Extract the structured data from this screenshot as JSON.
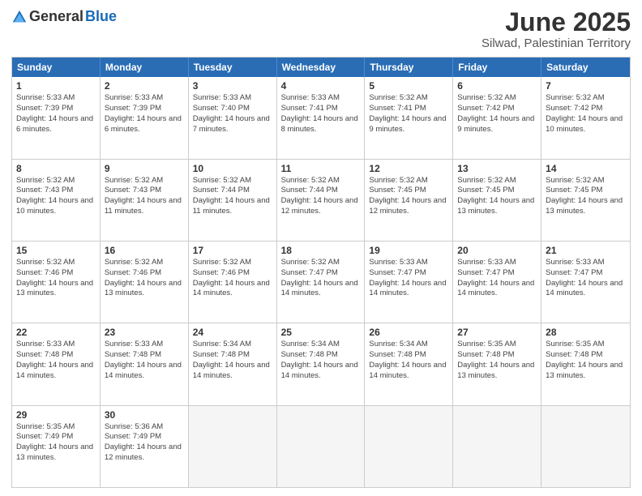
{
  "logo": {
    "general": "General",
    "blue": "Blue"
  },
  "title": "June 2025",
  "subtitle": "Silwad, Palestinian Territory",
  "headers": [
    "Sunday",
    "Monday",
    "Tuesday",
    "Wednesday",
    "Thursday",
    "Friday",
    "Saturday"
  ],
  "weeks": [
    [
      {
        "day": "1",
        "sunrise": "Sunrise: 5:33 AM",
        "sunset": "Sunset: 7:39 PM",
        "daylight": "Daylight: 14 hours and 6 minutes."
      },
      {
        "day": "2",
        "sunrise": "Sunrise: 5:33 AM",
        "sunset": "Sunset: 7:39 PM",
        "daylight": "Daylight: 14 hours and 6 minutes."
      },
      {
        "day": "3",
        "sunrise": "Sunrise: 5:33 AM",
        "sunset": "Sunset: 7:40 PM",
        "daylight": "Daylight: 14 hours and 7 minutes."
      },
      {
        "day": "4",
        "sunrise": "Sunrise: 5:33 AM",
        "sunset": "Sunset: 7:41 PM",
        "daylight": "Daylight: 14 hours and 8 minutes."
      },
      {
        "day": "5",
        "sunrise": "Sunrise: 5:32 AM",
        "sunset": "Sunset: 7:41 PM",
        "daylight": "Daylight: 14 hours and 9 minutes."
      },
      {
        "day": "6",
        "sunrise": "Sunrise: 5:32 AM",
        "sunset": "Sunset: 7:42 PM",
        "daylight": "Daylight: 14 hours and 9 minutes."
      },
      {
        "day": "7",
        "sunrise": "Sunrise: 5:32 AM",
        "sunset": "Sunset: 7:42 PM",
        "daylight": "Daylight: 14 hours and 10 minutes."
      }
    ],
    [
      {
        "day": "8",
        "sunrise": "Sunrise: 5:32 AM",
        "sunset": "Sunset: 7:43 PM",
        "daylight": "Daylight: 14 hours and 10 minutes."
      },
      {
        "day": "9",
        "sunrise": "Sunrise: 5:32 AM",
        "sunset": "Sunset: 7:43 PM",
        "daylight": "Daylight: 14 hours and 11 minutes."
      },
      {
        "day": "10",
        "sunrise": "Sunrise: 5:32 AM",
        "sunset": "Sunset: 7:44 PM",
        "daylight": "Daylight: 14 hours and 11 minutes."
      },
      {
        "day": "11",
        "sunrise": "Sunrise: 5:32 AM",
        "sunset": "Sunset: 7:44 PM",
        "daylight": "Daylight: 14 hours and 12 minutes."
      },
      {
        "day": "12",
        "sunrise": "Sunrise: 5:32 AM",
        "sunset": "Sunset: 7:45 PM",
        "daylight": "Daylight: 14 hours and 12 minutes."
      },
      {
        "day": "13",
        "sunrise": "Sunrise: 5:32 AM",
        "sunset": "Sunset: 7:45 PM",
        "daylight": "Daylight: 14 hours and 13 minutes."
      },
      {
        "day": "14",
        "sunrise": "Sunrise: 5:32 AM",
        "sunset": "Sunset: 7:45 PM",
        "daylight": "Daylight: 14 hours and 13 minutes."
      }
    ],
    [
      {
        "day": "15",
        "sunrise": "Sunrise: 5:32 AM",
        "sunset": "Sunset: 7:46 PM",
        "daylight": "Daylight: 14 hours and 13 minutes."
      },
      {
        "day": "16",
        "sunrise": "Sunrise: 5:32 AM",
        "sunset": "Sunset: 7:46 PM",
        "daylight": "Daylight: 14 hours and 13 minutes."
      },
      {
        "day": "17",
        "sunrise": "Sunrise: 5:32 AM",
        "sunset": "Sunset: 7:46 PM",
        "daylight": "Daylight: 14 hours and 14 minutes."
      },
      {
        "day": "18",
        "sunrise": "Sunrise: 5:32 AM",
        "sunset": "Sunset: 7:47 PM",
        "daylight": "Daylight: 14 hours and 14 minutes."
      },
      {
        "day": "19",
        "sunrise": "Sunrise: 5:33 AM",
        "sunset": "Sunset: 7:47 PM",
        "daylight": "Daylight: 14 hours and 14 minutes."
      },
      {
        "day": "20",
        "sunrise": "Sunrise: 5:33 AM",
        "sunset": "Sunset: 7:47 PM",
        "daylight": "Daylight: 14 hours and 14 minutes."
      },
      {
        "day": "21",
        "sunrise": "Sunrise: 5:33 AM",
        "sunset": "Sunset: 7:47 PM",
        "daylight": "Daylight: 14 hours and 14 minutes."
      }
    ],
    [
      {
        "day": "22",
        "sunrise": "Sunrise: 5:33 AM",
        "sunset": "Sunset: 7:48 PM",
        "daylight": "Daylight: 14 hours and 14 minutes."
      },
      {
        "day": "23",
        "sunrise": "Sunrise: 5:33 AM",
        "sunset": "Sunset: 7:48 PM",
        "daylight": "Daylight: 14 hours and 14 minutes."
      },
      {
        "day": "24",
        "sunrise": "Sunrise: 5:34 AM",
        "sunset": "Sunset: 7:48 PM",
        "daylight": "Daylight: 14 hours and 14 minutes."
      },
      {
        "day": "25",
        "sunrise": "Sunrise: 5:34 AM",
        "sunset": "Sunset: 7:48 PM",
        "daylight": "Daylight: 14 hours and 14 minutes."
      },
      {
        "day": "26",
        "sunrise": "Sunrise: 5:34 AM",
        "sunset": "Sunset: 7:48 PM",
        "daylight": "Daylight: 14 hours and 14 minutes."
      },
      {
        "day": "27",
        "sunrise": "Sunrise: 5:35 AM",
        "sunset": "Sunset: 7:48 PM",
        "daylight": "Daylight: 14 hours and 13 minutes."
      },
      {
        "day": "28",
        "sunrise": "Sunrise: 5:35 AM",
        "sunset": "Sunset: 7:48 PM",
        "daylight": "Daylight: 14 hours and 13 minutes."
      }
    ],
    [
      {
        "day": "29",
        "sunrise": "Sunrise: 5:35 AM",
        "sunset": "Sunset: 7:49 PM",
        "daylight": "Daylight: 14 hours and 13 minutes."
      },
      {
        "day": "30",
        "sunrise": "Sunrise: 5:36 AM",
        "sunset": "Sunset: 7:49 PM",
        "daylight": "Daylight: 14 hours and 12 minutes."
      },
      null,
      null,
      null,
      null,
      null
    ]
  ]
}
